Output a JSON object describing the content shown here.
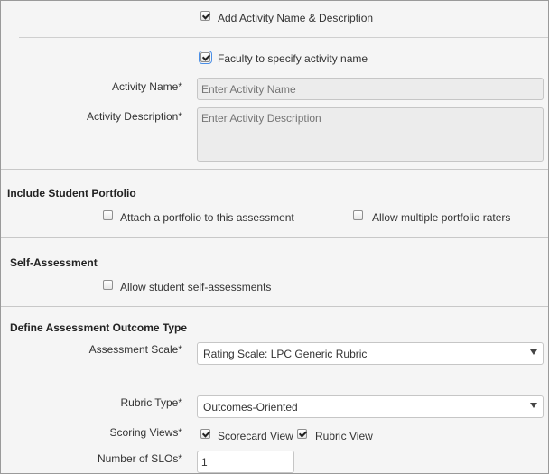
{
  "top": {
    "add_activity_label": "Add Activity Name & Description",
    "add_activity_checked": true
  },
  "activity": {
    "faculty_specify_label": "Faculty to specify activity name",
    "faculty_specify_checked": true,
    "name_label": "Activity Name*",
    "name_placeholder": "Enter Activity Name",
    "description_label": "Activity Description*",
    "description_placeholder": "Enter Activity Description"
  },
  "portfolio": {
    "heading": "Include Student Portfolio",
    "attach_label": "Attach a portfolio to this assessment",
    "attach_checked": false,
    "multiple_raters_label": "Allow multiple portfolio raters",
    "multiple_raters_checked": false
  },
  "self_assessment": {
    "heading": "Self-Assessment",
    "allow_label": "Allow student self-assessments",
    "allow_checked": false
  },
  "outcome": {
    "heading": "Define Assessment Outcome Type",
    "scale_label": "Assessment Scale*",
    "scale_value": "Rating Scale: LPC Generic Rubric",
    "rubric_type_label": "Rubric Type*",
    "rubric_type_value": "Outcomes-Oriented",
    "scoring_views_label": "Scoring Views*",
    "scorecard_label": "Scorecard View",
    "scorecard_checked": true,
    "rubric_view_label": "Rubric View",
    "rubric_view_checked": true,
    "slo_label": "Number of SLOs*",
    "slo_value": "1"
  },
  "icons": {
    "checkbox": "checkbox-icon",
    "dropdown": "chevron-down-icon"
  },
  "colors": {
    "background": "#f5f5f5",
    "focus_outline": "#4b8fe6",
    "input_disabled_bg": "#ececec"
  }
}
